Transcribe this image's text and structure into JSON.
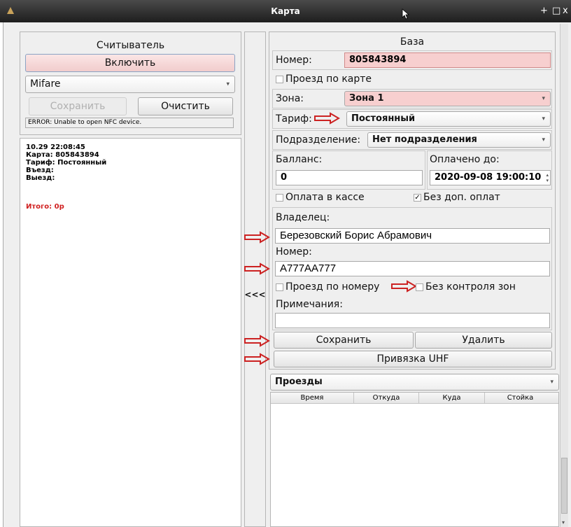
{
  "window": {
    "title": "Карта",
    "controls": [
      "+",
      "□",
      "x"
    ]
  },
  "reader": {
    "title": "Считыватель",
    "enable_label": "Включить",
    "card_type": "Mifare",
    "save_label": "Сохранить",
    "clear_label": "Очистить",
    "status": "ERROR: Unable to open NFC device."
  },
  "log": {
    "line1": "10.29 22:08:45",
    "line2": "Карта: 805843894",
    "line3": "Тариф: Постоянный",
    "line4": "Въезд:",
    "line5": "Выезд:",
    "total": "Итого: 0р"
  },
  "transfer_button": "<<<",
  "base": {
    "title": "База",
    "number_label": "Номер:",
    "number_value": "805843894",
    "card_pass_label": "Проезд по карте",
    "zone_label": "Зона:",
    "zone_value": "Зона 1",
    "tariff_label": "Тариф:",
    "tariff_value": "Постоянный",
    "division_label": "Подразделение:",
    "division_value": "Нет подразделения",
    "balance_label": "Балланс:",
    "balance_value": "0",
    "paid_until_label": "Оплачено до:",
    "paid_until_value": "2020-09-08 19:00:10",
    "cash_payment_label": "Оплата в кассе",
    "no_extra_label": "Без доп. оплат",
    "no_extra_checked": "✓",
    "owner_label": "Владелец:",
    "owner_value": "Березовский Борис Абрамович",
    "plate_label": "Номер:",
    "plate_value": "А777АА777",
    "plate_pass_label": "Проезд по номеру",
    "no_zone_control_label": "Без контроля зон",
    "notes_label": "Примечания:",
    "notes_value": "",
    "save_label": "Сохранить",
    "delete_label": "Удалить",
    "uhf_label": "Привязка UHF"
  },
  "passes": {
    "combo_value": "Проезды",
    "columns": [
      "Время",
      "Откуда",
      "Куда",
      "Стойка"
    ]
  },
  "colors": {
    "accent_arrow": "#cc2222",
    "error_text": "#d02020",
    "highlight": "#f7cfcf"
  }
}
